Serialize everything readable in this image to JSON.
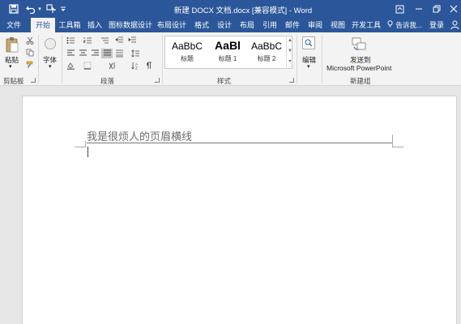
{
  "titlebar": {
    "title": "新建 DOCX 文档.docx [兼容模式] - Word"
  },
  "tabs": {
    "file": "文件",
    "home": "开始",
    "toolbox": "工具箱",
    "insert": "插入",
    "chart_design": "图标数据设计",
    "layout_design": "布局设计",
    "format": "格式",
    "design": "设计",
    "layout": "布局",
    "references": "引用",
    "mailings": "邮件",
    "review": "审阅",
    "view": "视图",
    "developer": "开发工具",
    "tell_me": "告诉我...",
    "login": "登录"
  },
  "ribbon": {
    "paste_label": "粘贴",
    "font_label": "字体",
    "clipboard_group": "剪贴板",
    "paragraph_group": "段落",
    "styles_group": "样式",
    "edit_label": "编辑",
    "send_to_line1": "发送到",
    "send_to_line2": "Microsoft PowerPoint",
    "new_group": "新建组",
    "styles": [
      {
        "preview": "AaBbC",
        "name": "标题"
      },
      {
        "preview": "AaBl",
        "name": "标题 1"
      },
      {
        "preview": "AaBbC",
        "name": "标题 2"
      }
    ]
  },
  "document": {
    "header_text": "我是很烦人的页眉横线"
  }
}
